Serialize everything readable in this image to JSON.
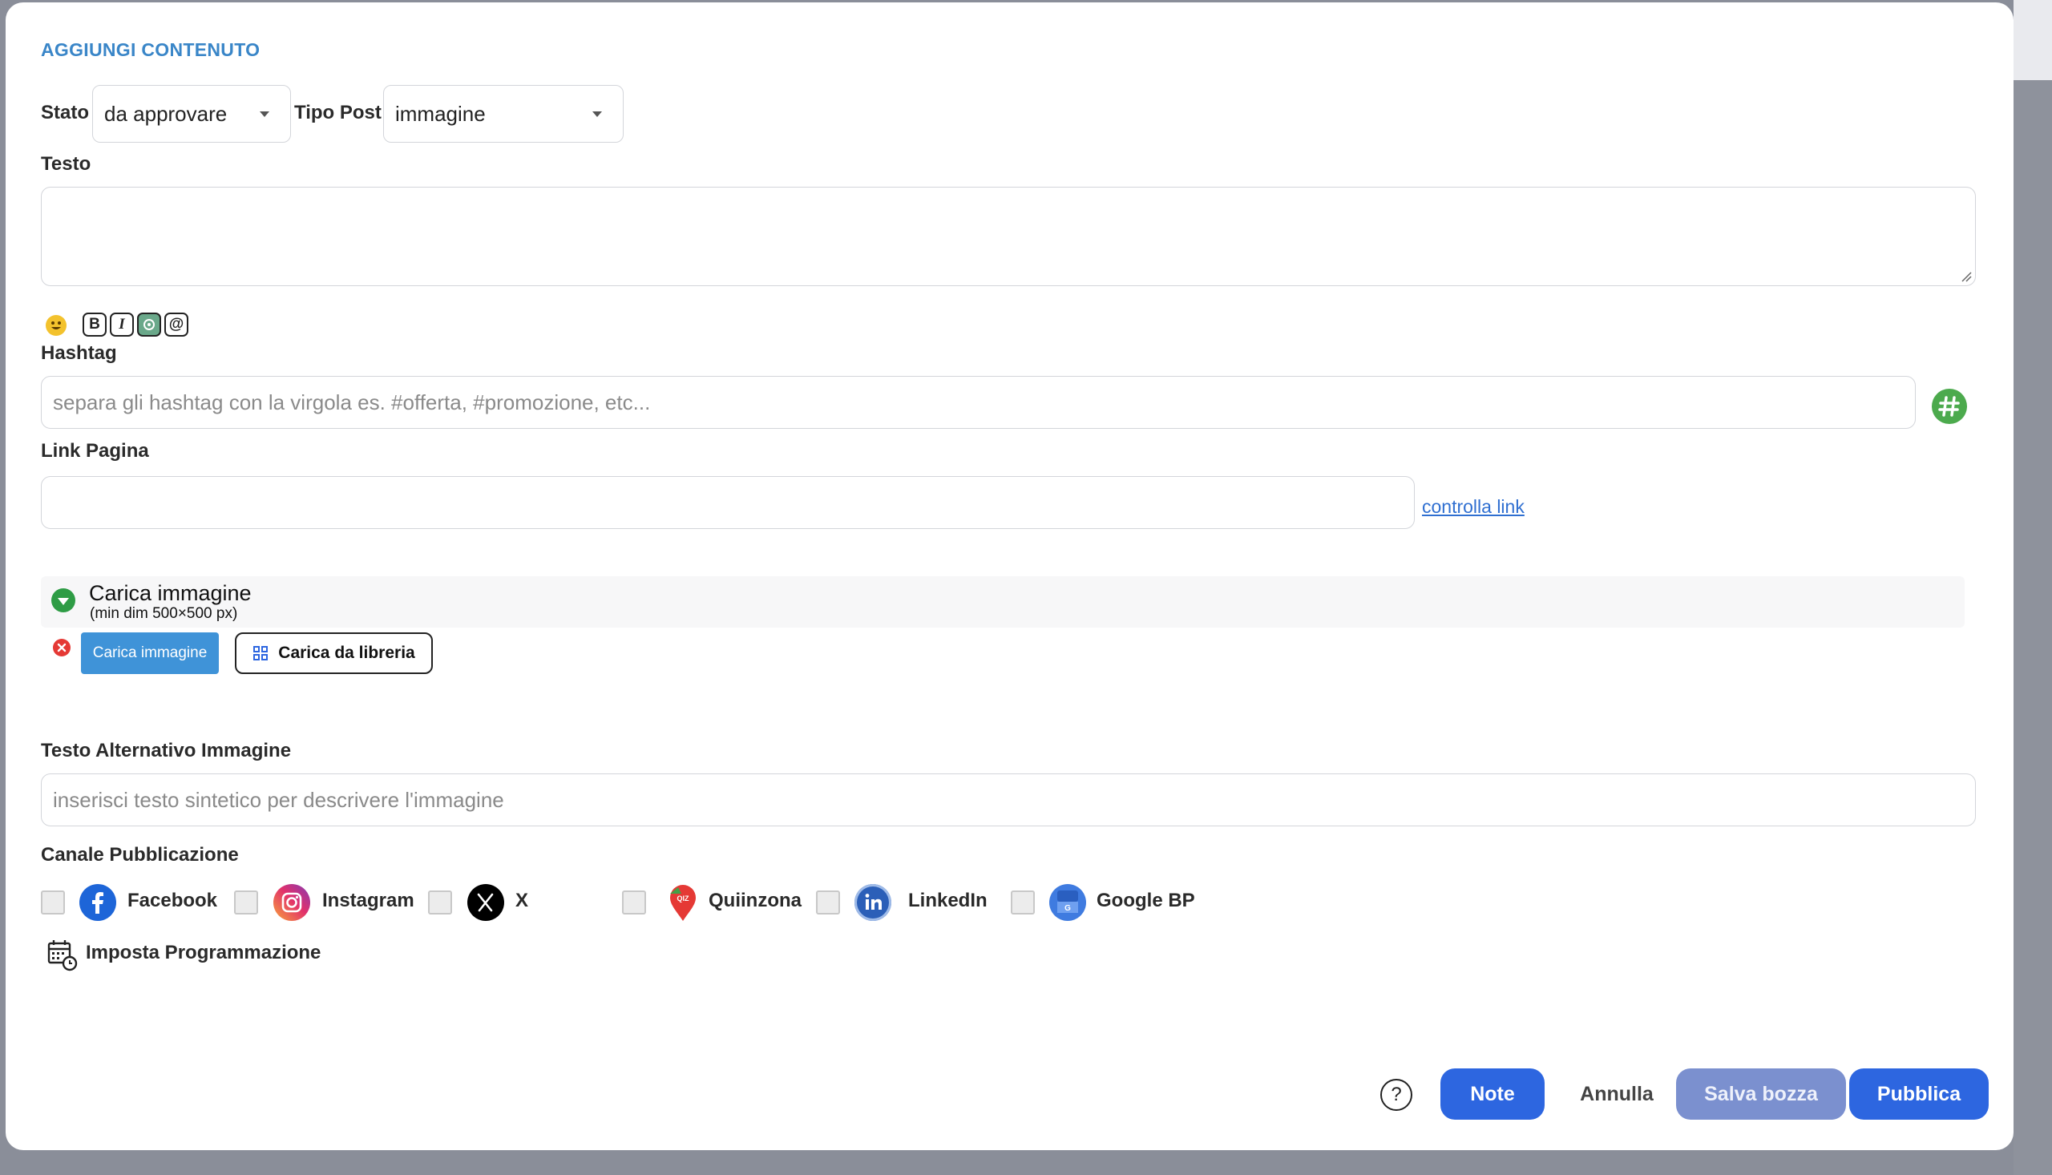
{
  "modal": {
    "title": "AGGIUNGI CONTENUTO"
  },
  "stato": {
    "label": "Stato",
    "value": "da approvare"
  },
  "tipo_post": {
    "label": "Tipo Post",
    "value": "immagine"
  },
  "testo": {
    "label": "Testo",
    "value": ""
  },
  "toolbar": {
    "bold": "B",
    "italic": "I",
    "mention": "@"
  },
  "hashtag": {
    "label": "Hashtag",
    "placeholder": "separa gli hashtag con la virgola es. #offerta, #promozione, etc..."
  },
  "link_pagina": {
    "label": "Link Pagina",
    "value": "",
    "check_link": "controlla link"
  },
  "upload": {
    "title": "Carica immagine",
    "subtitle": "(min dim 500×500 px)",
    "upload_button": "Carica immagine",
    "library_button": "Carica da libreria"
  },
  "alt_text": {
    "label": "Testo Alternativo Immagine",
    "placeholder": "inserisci testo sintetico per descrivere l'immagine"
  },
  "channels": {
    "label": "Canale Pubblicazione",
    "items": [
      {
        "name": "Facebook",
        "icon": "facebook-icon",
        "color": "#1d65d8"
      },
      {
        "name": "Instagram",
        "icon": "instagram-icon",
        "color": "#d62976"
      },
      {
        "name": "X",
        "icon": "x-icon",
        "color": "#000000"
      },
      {
        "name": "Quiinzona",
        "icon": "quiinzona-icon",
        "color": "#e53935"
      },
      {
        "name": "LinkedIn",
        "icon": "linkedin-icon",
        "color": "#2b5fb8"
      },
      {
        "name": "Google BP",
        "icon": "google-bp-icon",
        "color": "#3f7be0"
      }
    ]
  },
  "schedule": {
    "label": "Imposta Programmazione"
  },
  "footer": {
    "help": "?",
    "note": "Note",
    "cancel": "Annulla",
    "save_draft": "Salva bozza",
    "publish": "Pubblica"
  },
  "colors": {
    "accent": "#3a86c8",
    "primary_button": "#2d66e0",
    "draft_button": "#7b90cf",
    "hashtag_button": "#4caa4d"
  }
}
